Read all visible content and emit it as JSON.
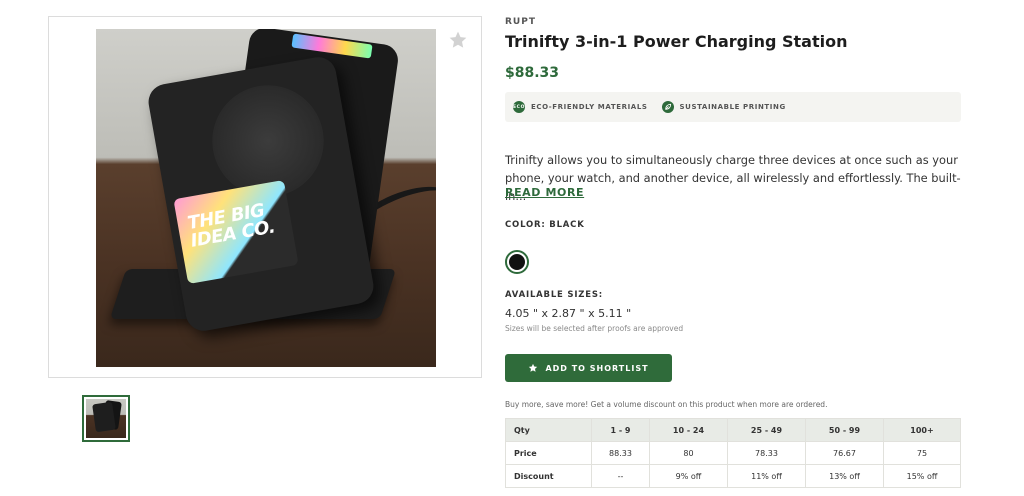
{
  "gallery": {
    "logo_text": "THE BIG IDEA CO.",
    "favorite_icon": "star-icon"
  },
  "product": {
    "brand": "RUPT",
    "title": "Trinifty 3-in-1 Power Charging Station",
    "price": "$88.33",
    "badges": [
      {
        "icon_text": "ECO",
        "label": "ECO-FRIENDLY MATERIALS"
      },
      {
        "icon": "leaf-icon",
        "label": "SUSTAINABLE PRINTING"
      }
    ],
    "description": "Trinifty allows you to simultaneously charge three devices at once such as your phone, your watch, and another device, all wirelessly and effortlessly. The built-in...",
    "read_more": "READ MORE",
    "color_label": "COLOR: BLACK",
    "selected_color": "#111111",
    "sizes_label": "AVAILABLE SIZES:",
    "sizes_value": "4.05 \" x 2.87 \" x 5.11 \"",
    "sizes_note": "Sizes will be selected after proofs are approved",
    "shortlist_label": "ADD TO SHORTLIST",
    "volume_note": "Buy more, save more! Get a volume discount on this product when more are ordered."
  },
  "pricing": {
    "headers": [
      "Qty",
      "1 - 9",
      "10 - 24",
      "25 - 49",
      "50 - 99",
      "100+"
    ],
    "price_row": [
      "Price",
      "88.33",
      "80",
      "78.33",
      "76.67",
      "75"
    ],
    "discount_row": [
      "Discount",
      "--",
      "9% off",
      "11% off",
      "13% off",
      "15% off"
    ]
  },
  "colors": {
    "accent": "#2e6a3b",
    "button": "#2f6b3a",
    "table_header": "#e8ebe6"
  }
}
